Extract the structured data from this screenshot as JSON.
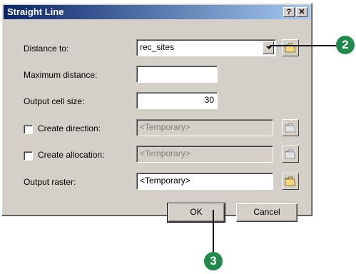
{
  "dialog": {
    "title": "Straight Line",
    "help_label": "?",
    "close_label": "✕"
  },
  "form": {
    "distance_to": {
      "label": "Distance to:",
      "value": "rec_sites"
    },
    "maximum_distance": {
      "label": "Maximum distance:",
      "value": ""
    },
    "output_cell_size": {
      "label": "Output cell size:",
      "value": "30"
    },
    "create_direction": {
      "label": "Create direction:",
      "value": "<Temporary>",
      "checked": false
    },
    "create_allocation": {
      "label": "Create allocation:",
      "value": "<Temporary>",
      "checked": false
    },
    "output_raster": {
      "label": "Output raster:",
      "value": "<Temporary>"
    }
  },
  "buttons": {
    "ok_label": "OK",
    "cancel_label": "Cancel"
  },
  "callouts": {
    "c1": "2",
    "c2": "3",
    "color": "#1f8a4c"
  },
  "icons": {
    "folder": "open-folder-icon",
    "dropdown": "chevron-down-icon"
  }
}
